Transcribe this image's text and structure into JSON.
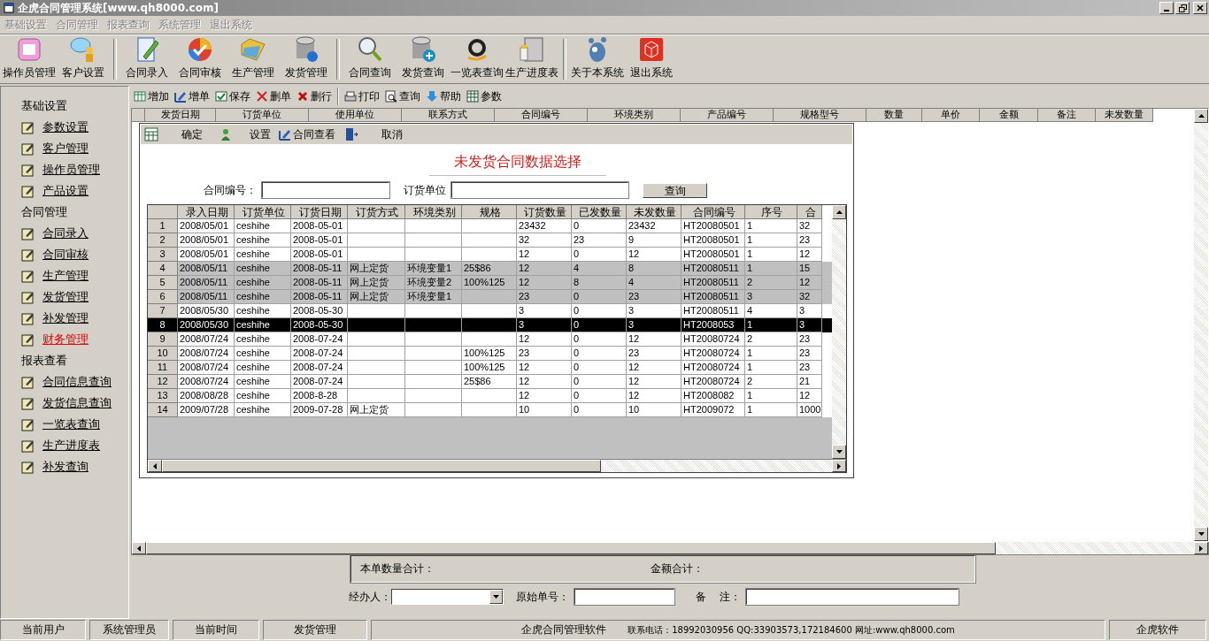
{
  "window": {
    "title": "企虎合同管理系统[www.qh8000.com]"
  },
  "menu": [
    {
      "label": "基础设置",
      "disabled": true
    },
    {
      "label": "合同管理",
      "disabled": true
    },
    {
      "label": "报表查询",
      "disabled": true
    },
    {
      "label": "系统管理",
      "disabled": true
    },
    {
      "label": "退出系统",
      "disabled": true
    }
  ],
  "toolbar": [
    [
      "操作员管理",
      "客户设置"
    ],
    [
      "合同录入",
      "合同审核",
      "生产管理",
      "发货管理"
    ],
    [
      "合同查询",
      "发货查询",
      "一览表查询",
      "生产进度表"
    ],
    [
      "关于本系统",
      "退出系统"
    ]
  ],
  "sidebar": [
    {
      "heading": "基础设置",
      "items": [
        {
          "label": "参数设置",
          "selected": false
        },
        {
          "label": "客户管理",
          "selected": false
        },
        {
          "label": "操作员管理",
          "selected": false
        },
        {
          "label": "产品设置",
          "selected": false
        }
      ]
    },
    {
      "heading": "合同管理",
      "items": [
        {
          "label": "合同录入",
          "selected": false
        },
        {
          "label": "合同审核",
          "selected": false
        },
        {
          "label": "生产管理",
          "selected": false
        },
        {
          "label": "发货管理",
          "selected": false
        },
        {
          "label": "补发管理",
          "selected": false
        },
        {
          "label": "财务管理",
          "selected": true
        }
      ]
    },
    {
      "heading": "报表查看",
      "items": [
        {
          "label": "合同信息查询",
          "selected": false
        },
        {
          "label": "发货信息查询",
          "selected": false
        },
        {
          "label": "一览表查询",
          "selected": false
        },
        {
          "label": "生产进度表",
          "selected": false
        },
        {
          "label": "补发查询",
          "selected": false
        }
      ]
    }
  ],
  "actions": [
    [
      "增加",
      "增单",
      "保存",
      "删单",
      "删行"
    ],
    [
      "打印",
      "查询",
      "帮助",
      "参数"
    ]
  ],
  "table": {
    "columns": [
      "发货日期",
      "订货单位",
      "使用单位",
      "联系方式",
      "合同编号",
      "环境类别",
      "产品编号",
      "规格型号",
      "数量",
      "单价",
      "金额",
      "备注",
      "未发数量"
    ]
  },
  "dialog": {
    "toolbar": [
      "确定",
      "设置",
      "合同查看",
      "取消"
    ],
    "title": "未发货合同数据选择",
    "search": {
      "contract_label": "合同编号：",
      "customer_label": "订货单位",
      "button": "查询"
    },
    "grid": {
      "columns": [
        "录入日期",
        "订货单位",
        "订货日期",
        "订货方式",
        "环境类别",
        "规格",
        "订货数量",
        "已发数量",
        "未发数量",
        "合同编号",
        "序号",
        "合"
      ],
      "rows": [
        {
          "number": "1",
          "shaded": false,
          "selected": false,
          "cells": [
            "2008/05/01",
            "ceshihe",
            "2008-05-01",
            "",
            "",
            "",
            "23432",
            "0",
            "23432",
            "HT20080501",
            "1",
            "32"
          ]
        },
        {
          "number": "2",
          "shaded": false,
          "selected": false,
          "cells": [
            "2008/05/01",
            "ceshihe",
            "2008-05-01",
            "",
            "",
            "",
            "32",
            "23",
            "9",
            "HT20080501",
            "1",
            "23"
          ]
        },
        {
          "number": "3",
          "shaded": false,
          "selected": false,
          "cells": [
            "2008/05/01",
            "ceshihe",
            "2008-05-01",
            "",
            "",
            "",
            "12",
            "0",
            "12",
            "HT20080501",
            "1",
            "12"
          ]
        },
        {
          "number": "4",
          "shaded": true,
          "selected": false,
          "cells": [
            "2008/05/11",
            "ceshihe",
            "2008-05-11",
            "网上定货",
            "环境变量1",
            "25$86",
            "12",
            "4",
            "8",
            "HT20080511",
            "1",
            "15"
          ]
        },
        {
          "number": "5",
          "shaded": true,
          "selected": false,
          "cells": [
            "2008/05/11",
            "ceshihe",
            "2008-05-11",
            "网上定货",
            "环境变量2",
            "100%125",
            "12",
            "8",
            "4",
            "HT20080511",
            "2",
            "12"
          ]
        },
        {
          "number": "6",
          "shaded": true,
          "selected": false,
          "cells": [
            "2008/05/11",
            "ceshihe",
            "2008-05-11",
            "网上定货",
            "环境变量1",
            "",
            "23",
            "0",
            "23",
            "HT20080511",
            "3",
            "32"
          ]
        },
        {
          "number": "7",
          "shaded": false,
          "selected": false,
          "cells": [
            "2008/05/30",
            "ceshihe",
            "2008-05-30",
            "",
            "",
            "",
            "3",
            "0",
            "3",
            "HT20080511",
            "4",
            "3"
          ]
        },
        {
          "number": "8",
          "shaded": false,
          "selected": true,
          "cells": [
            "2008/05/30",
            "ceshihe",
            "2008-05-30",
            "",
            "",
            "",
            "3",
            "0",
            "3",
            "HT2008053",
            "1",
            "3"
          ]
        },
        {
          "number": "9",
          "shaded": false,
          "selected": false,
          "cells": [
            "2008/07/24",
            "ceshihe",
            "2008-07-24",
            "",
            "",
            "",
            "12",
            "0",
            "12",
            "HT20080724",
            "2",
            "23"
          ]
        },
        {
          "number": "10",
          "shaded": false,
          "selected": false,
          "cells": [
            "2008/07/24",
            "ceshihe",
            "2008-07-24",
            "",
            "",
            "100%125",
            "23",
            "0",
            "23",
            "HT20080724",
            "1",
            "23"
          ]
        },
        {
          "number": "11",
          "shaded": false,
          "selected": false,
          "cells": [
            "2008/07/24",
            "ceshihe",
            "2008-07-24",
            "",
            "",
            "100%125",
            "12",
            "0",
            "12",
            "HT20080724",
            "1",
            "23"
          ]
        },
        {
          "number": "12",
          "shaded": false,
          "selected": false,
          "cells": [
            "2008/07/24",
            "ceshihe",
            "2008-07-24",
            "",
            "",
            "25$86",
            "12",
            "0",
            "12",
            "HT20080724",
            "2",
            "21"
          ]
        },
        {
          "number": "13",
          "shaded": false,
          "selected": false,
          "cells": [
            "2008/08/28",
            "ceshihe",
            "2008-8-28",
            "",
            "",
            "",
            "12",
            "0",
            "12",
            "HT2008082",
            "1",
            "12"
          ]
        },
        {
          "number": "14",
          "shaded": false,
          "selected": false,
          "cells": [
            "2009/07/28",
            "ceshihe",
            "2009-07-28",
            "网上定货",
            "",
            "",
            "10",
            "0",
            "10",
            "HT2009072",
            "1",
            "1000"
          ]
        }
      ]
    }
  },
  "summary": {
    "quantity_total": "本单数量合计：",
    "amount_total": "金额合计：",
    "handler_label": "经办人：",
    "original_no_label": "原始单号：",
    "note_label": "备    注："
  },
  "status_bar": {
    "panels": [
      "当前用户",
      "系统管理员",
      "当前时间",
      "发货管理"
    ],
    "product": "企虎合同管理软件",
    "contact": "联系电话：18992030956 QQ:33903573,172184600 网址:www.qh8000.com",
    "company": "企虎软件"
  }
}
